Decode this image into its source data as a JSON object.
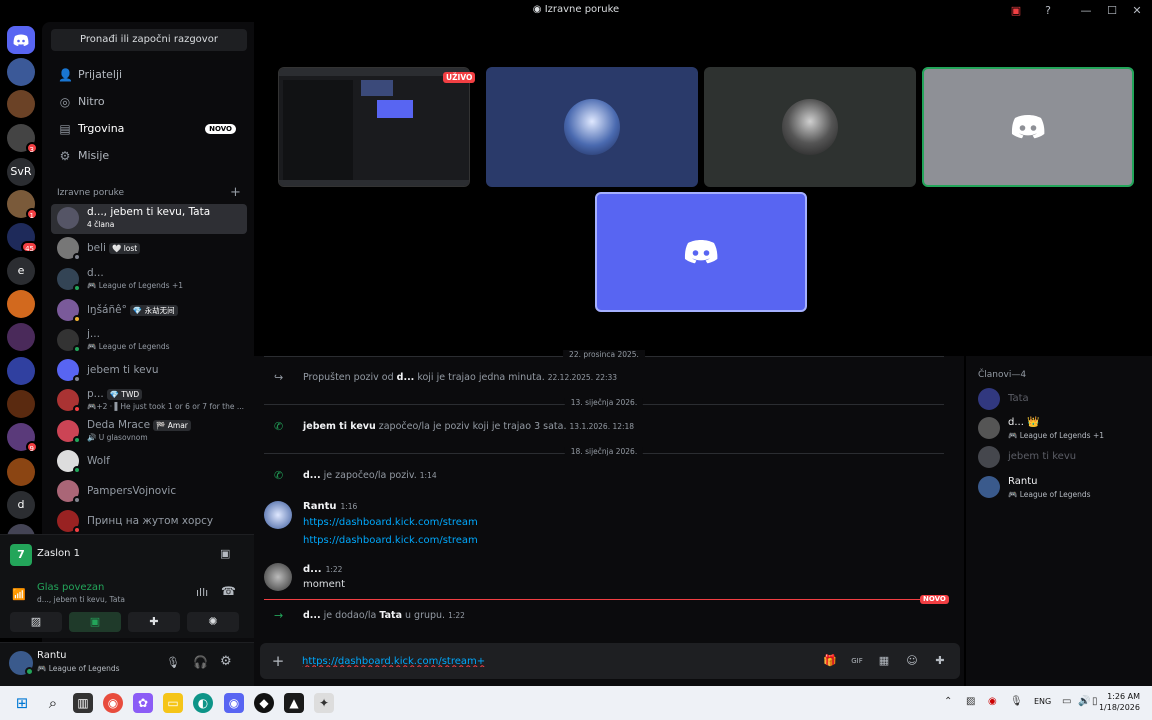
{
  "window": {
    "title": "Izravne poruke",
    "controls": [
      "—",
      "☐",
      "✕"
    ]
  },
  "servers": [
    {
      "label": "",
      "badge": ""
    },
    {
      "label": "",
      "badge": ""
    },
    {
      "label": "",
      "badge": "3"
    },
    {
      "label": "SvR",
      "badge": ""
    },
    {
      "label": "",
      "badge": "1"
    },
    {
      "label": "",
      "badge": "45"
    },
    {
      "label": "e",
      "badge": ""
    },
    {
      "label": "",
      "badge": ""
    },
    {
      "label": "",
      "badge": ""
    },
    {
      "label": "",
      "badge": ""
    },
    {
      "label": "",
      "badge": ""
    },
    {
      "label": "",
      "badge": "9"
    },
    {
      "label": "",
      "badge": ""
    },
    {
      "label": "d",
      "badge": ""
    },
    {
      "label": "",
      "badge": "6"
    }
  ],
  "sidebar": {
    "find_button": "Pronađi ili započni razgovor",
    "nav": [
      {
        "label": "Prijatelji"
      },
      {
        "label": "Nitro"
      },
      {
        "label": "Trgovina",
        "badge": "NOVO"
      },
      {
        "label": "Misije"
      }
    ],
    "dm_header": "Izravne poruke",
    "dm_add": "+",
    "dms": [
      {
        "name": "d..., jebem ti kevu, Tata",
        "sub": "4 člana"
      },
      {
        "name": "beli",
        "tag": "🤍 lost",
        "sub": ""
      },
      {
        "name": "d...",
        "sub": "🎮 League of Legends +1"
      },
      {
        "name": "lŋšáñê°",
        "tag": "💎 永劫无间",
        "sub": ""
      },
      {
        "name": "j...",
        "sub": "🎮 League of Legends"
      },
      {
        "name": "jebem ti kevu",
        "sub": ""
      },
      {
        "name": "p...",
        "tag": "💎 TWD",
        "sub": "🎮+2 · ▌He just took 1 or 6 or 7 for the ..."
      },
      {
        "name": "Deda Mrace",
        "tag": "🏁 Amar",
        "sub": "🔊 U glasovnom"
      },
      {
        "name": "Wolf",
        "sub": ""
      },
      {
        "name": "PampersVojnovic",
        "sub": ""
      },
      {
        "name": "Принц на жутом хорсу",
        "sub": ""
      }
    ]
  },
  "screen_share": {
    "label": "Zaslon 1",
    "icon_letter": "7"
  },
  "voice": {
    "status": "Glas povezan",
    "channel": "d..., jebem ti kevu, Tata"
  },
  "user": {
    "name": "Rantu",
    "activity": "🎮 League of Legends"
  },
  "video": {
    "live_label": "UŽIVO"
  },
  "chat": {
    "dividers": [
      "22. prosinca 2025.",
      "13. siječnja 2026.",
      "18. siječnja 2026."
    ],
    "missed_call": {
      "prefix": "Propušten poziv od ",
      "author": "d...",
      "suffix": " koji je trajao jedna minuta.",
      "ts": "22.12.2025. 22:33"
    },
    "call_started_1": {
      "author": "jebem ti kevu",
      "text": " započeo/la je poziv koji je trajao 3 sata.",
      "ts": "13.1.2026. 12:18"
    },
    "call_started_2": {
      "author": "d...",
      "text": " je započeo/la poziv.",
      "ts": "1:14"
    },
    "msg1": {
      "author": "Rantu",
      "ts": "1:16",
      "lines": [
        "https://dashboard.kick.com/stream",
        "https://dashboard.kick.com/stream"
      ]
    },
    "msg2": {
      "author": "d...",
      "ts": "1:22",
      "text": "moment"
    },
    "new_badge": "NOVO",
    "added": {
      "author": "d...",
      "mid": " je dodao/la ",
      "target": "Tata",
      "suffix": " u grupu.",
      "ts": "1:22"
    },
    "composer_value": "https://dashboard.kick.com/stream+"
  },
  "members": {
    "header": "Članovi—4",
    "list": [
      {
        "name": "Tata",
        "sub": "",
        "online": false
      },
      {
        "name": "d... 👑",
        "sub": "🎮 League of Legends +1",
        "online": true
      },
      {
        "name": "jebem ti kevu",
        "sub": "",
        "online": false
      },
      {
        "name": "Rantu",
        "sub": "🎮 League of Legends",
        "online": true
      }
    ]
  },
  "taskbar": {
    "lang": "ENG",
    "time": "1:26 AM",
    "date": "1/18/2026"
  },
  "colors": {
    "blurple": "#5865f2",
    "green": "#23a55a",
    "red": "#f23f43",
    "link": "#00a8fc"
  }
}
